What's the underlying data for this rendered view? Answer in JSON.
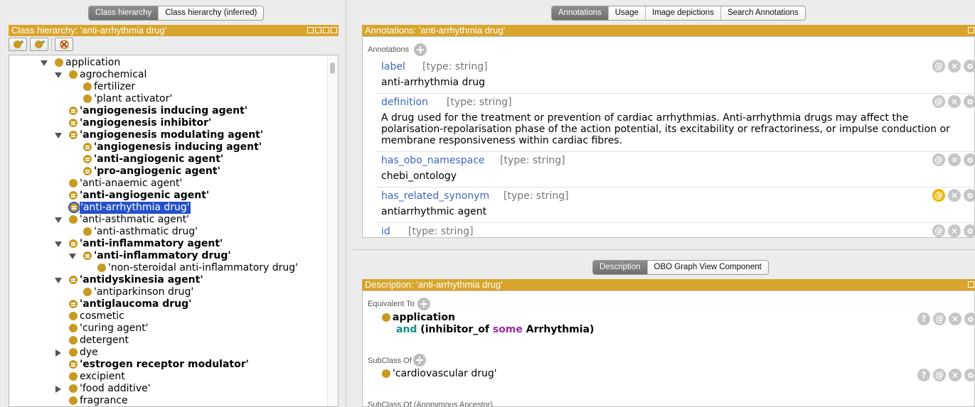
{
  "left": {
    "tabs": [
      {
        "label": "Class hierarchy",
        "active": true
      },
      {
        "label": "Class hierarchy (inferred)",
        "active": false
      }
    ],
    "header": "Class hierarchy: 'anti-arrhythmia drug'",
    "toolbar": {
      "icons": [
        "add-subclass-icon",
        "add-sibling-icon",
        "delete-class-icon"
      ]
    },
    "tree": [
      {
        "label": "application",
        "bold": false,
        "equiv": false,
        "toggle": "open"
      },
      {
        "label": "agrochemical",
        "bold": false,
        "equiv": false,
        "toggle": "open"
      },
      {
        "label": "fertilizer",
        "bold": false,
        "equiv": false,
        "toggle": "none"
      },
      {
        "label": "'plant activator'",
        "bold": false,
        "equiv": false,
        "toggle": "none"
      },
      {
        "label": "'angiogenesis inducing agent'",
        "bold": true,
        "equiv": true,
        "toggle": "none"
      },
      {
        "label": "'angiogenesis inhibitor'",
        "bold": true,
        "equiv": true,
        "toggle": "none"
      },
      {
        "label": "'angiogenesis modulating agent'",
        "bold": true,
        "equiv": true,
        "toggle": "open"
      },
      {
        "label": "'angiogenesis inducing agent'",
        "bold": true,
        "equiv": true,
        "toggle": "none"
      },
      {
        "label": "'anti-angiogenic agent'",
        "bold": true,
        "equiv": true,
        "toggle": "none"
      },
      {
        "label": "'pro-angiogenic agent'",
        "bold": true,
        "equiv": true,
        "toggle": "none"
      },
      {
        "label": "'anti-anaemic agent'",
        "bold": false,
        "equiv": false,
        "toggle": "none"
      },
      {
        "label": "'anti-angiogenic agent'",
        "bold": true,
        "equiv": true,
        "toggle": "none"
      },
      {
        "label": "'anti-arrhythmia drug'",
        "bold": false,
        "equiv": true,
        "toggle": "none",
        "selected": true
      },
      {
        "label": "'anti-asthmatic agent'",
        "bold": false,
        "equiv": false,
        "toggle": "open"
      },
      {
        "label": "'anti-asthmatic drug'",
        "bold": false,
        "equiv": false,
        "toggle": "none"
      },
      {
        "label": "'anti-inflammatory agent'",
        "bold": true,
        "equiv": true,
        "toggle": "open"
      },
      {
        "label": "'anti-inflammatory drug'",
        "bold": true,
        "equiv": true,
        "toggle": "open"
      },
      {
        "label": "'non-steroidal anti-inflammatory drug'",
        "bold": false,
        "equiv": false,
        "toggle": "none"
      },
      {
        "label": "'antidyskinesia agent'",
        "bold": true,
        "equiv": true,
        "toggle": "open"
      },
      {
        "label": "'antiparkinson drug'",
        "bold": false,
        "equiv": false,
        "toggle": "none"
      },
      {
        "label": "'antiglaucoma drug'",
        "bold": true,
        "equiv": true,
        "toggle": "none"
      },
      {
        "label": "cosmetic",
        "bold": false,
        "equiv": false,
        "toggle": "none"
      },
      {
        "label": "'curing agent'",
        "bold": false,
        "equiv": false,
        "toggle": "none"
      },
      {
        "label": "detergent",
        "bold": false,
        "equiv": false,
        "toggle": "none"
      },
      {
        "label": "dye",
        "bold": false,
        "equiv": false,
        "toggle": "closed"
      },
      {
        "label": "'estrogen receptor modulator'",
        "bold": true,
        "equiv": true,
        "toggle": "none"
      },
      {
        "label": "excipient",
        "bold": false,
        "equiv": false,
        "toggle": "none"
      },
      {
        "label": "'food additive'",
        "bold": false,
        "equiv": false,
        "toggle": "closed"
      },
      {
        "label": "fragrance",
        "bold": false,
        "equiv": false,
        "toggle": "none"
      }
    ]
  },
  "annotations": {
    "tabs": [
      {
        "label": "Annotations",
        "active": true
      },
      {
        "label": "Usage",
        "active": false
      },
      {
        "label": "Image depictions",
        "active": false
      },
      {
        "label": "Search Annotations",
        "active": false
      }
    ],
    "header": "Annotations: 'anti-arrhythmia drug'",
    "section_label": "Annotations",
    "rows": [
      {
        "property": "label",
        "type": "[type: string]",
        "value": "anti-arrhythmia drug"
      },
      {
        "property": "definition",
        "type": "[type: string]",
        "value": "A drug used for the treatment or prevention of cardiac arrhythmias. Anti-arrhythmia drugs may affect the polarisation-repolarisation phase of the action potential, its excitability or refractoriness, or impulse conduction or membrane responsiveness within cardiac fibres."
      },
      {
        "property": "has_obo_namespace",
        "type": "[type: string]",
        "value": "chebi_ontology"
      },
      {
        "property": "has_related_synonym",
        "type": "[type: string]",
        "value": "antiarrhythmic agent",
        "highlight": true
      },
      {
        "property": "id",
        "type": "[type: string]",
        "value": ""
      }
    ],
    "row_buttons": {
      "annotate": "@",
      "delete": "×",
      "edit": "o"
    }
  },
  "description": {
    "tabs": [
      {
        "label": "Description",
        "active": true
      },
      {
        "label": "OBO Graph View Component",
        "active": false
      }
    ],
    "header": "Description: 'anti-arrhythmia drug'",
    "equivalent_label": "Equivalent To",
    "equivalent": {
      "line1": "application",
      "and": "and",
      "pre": " (inhibitor_of ",
      "some": "some",
      "post": " Arrhythmia)"
    },
    "subclass_label": "SubClass Of",
    "subclass": "'cardiovascular drug'",
    "ancestor_label": "SubClass Of (Anonymous Ancestor)",
    "row_buttons": {
      "explain": "?",
      "annotate": "@",
      "delete": "×",
      "edit": "o"
    }
  }
}
